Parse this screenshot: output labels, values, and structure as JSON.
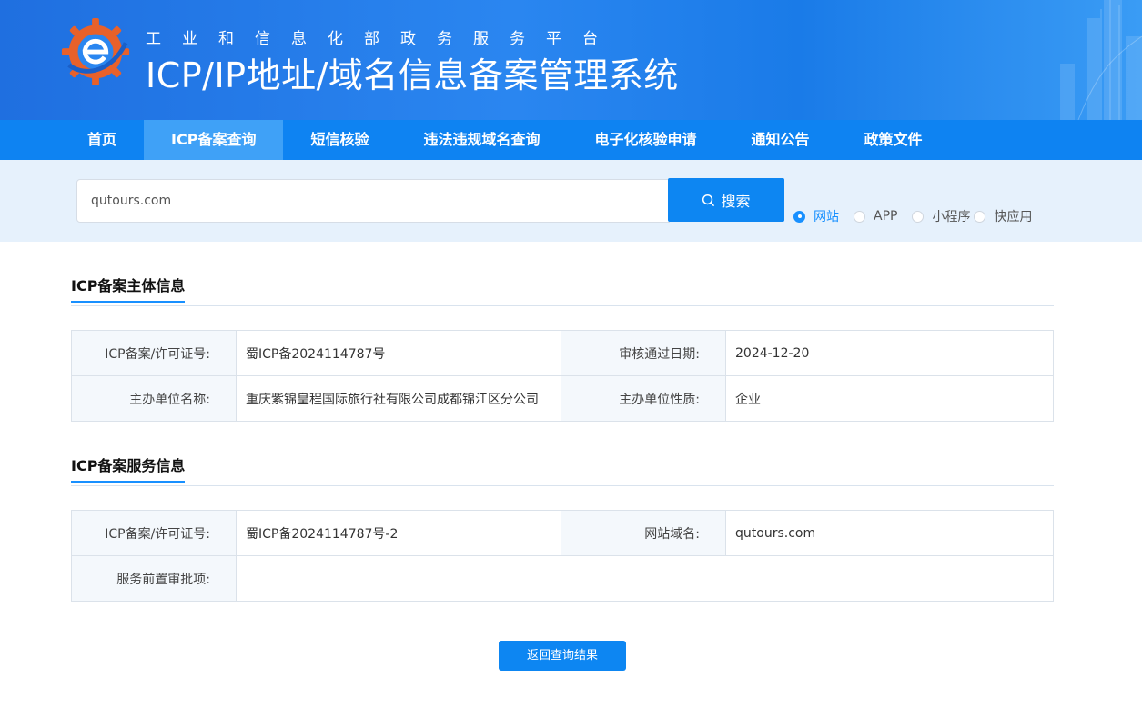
{
  "header": {
    "subtitle": "工业和信息化部政务服务平台",
    "title": "ICP/IP地址/域名信息备案管理系统"
  },
  "nav": {
    "items": [
      {
        "label": "首页"
      },
      {
        "label": "ICP备案查询",
        "active": true
      },
      {
        "label": "短信核验"
      },
      {
        "label": "违法违规域名查询"
      },
      {
        "label": "电子化核验申请"
      },
      {
        "label": "通知公告"
      },
      {
        "label": "政策文件"
      }
    ]
  },
  "search": {
    "value": "qutours.com",
    "button_label": "搜索",
    "button_icon": "search-icon",
    "types": [
      {
        "label": "网站",
        "checked": true
      },
      {
        "label": "APP",
        "checked": false
      },
      {
        "label": "小程序",
        "checked": false
      },
      {
        "label": "快应用",
        "checked": false
      }
    ]
  },
  "subject_info": {
    "title": "ICP备案主体信息",
    "rows": [
      {
        "k1": "ICP备案/许可证号:",
        "v1": "蜀ICP备2024114787号",
        "k2": "审核通过日期:",
        "v2": "2024-12-20"
      },
      {
        "k1": "主办单位名称:",
        "v1": "重庆紫锦皇程国际旅行社有限公司成都锦江区分公司",
        "k2": "主办单位性质:",
        "v2": "企业"
      }
    ]
  },
  "service_info": {
    "title": "ICP备案服务信息",
    "row1": {
      "k1": "ICP备案/许可证号:",
      "v1": "蜀ICP备2024114787号-2",
      "k2": "网站域名:",
      "v2": "qutours.com"
    },
    "row2": {
      "k1": "服务前置审批项:",
      "v1": ""
    }
  },
  "back_button_label": "返回查询结果",
  "colors": {
    "primary": "#0d86f2",
    "nav_active": "#3fa1f7",
    "search_band": "#e6f1fc"
  }
}
